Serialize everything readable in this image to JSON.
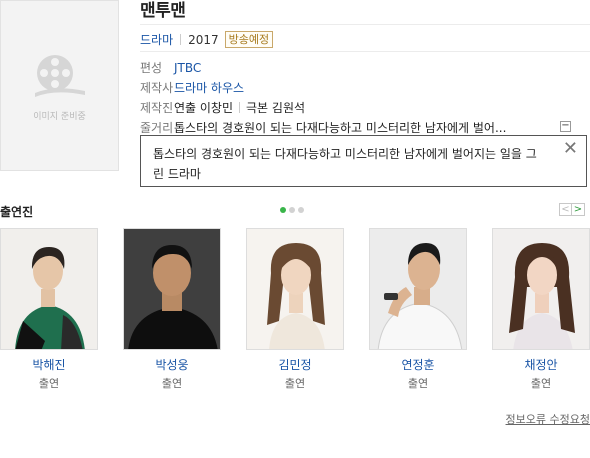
{
  "poster": {
    "placeholder_text": "이미지 준비중"
  },
  "title": "맨투맨",
  "meta": {
    "genre": "드라마",
    "year": "2017",
    "status_badge": "방송예정"
  },
  "info": [
    {
      "label": "편성",
      "value": "JTBC"
    },
    {
      "label": "제작사",
      "value": "드라마 하우스"
    },
    {
      "label": "제작진",
      "value": "연출 이창민",
      "value2": "극본 김원석"
    },
    {
      "label": "줄거리",
      "value": "톱스타의 경호원이 되는 다재다능하고 미스터리한 남자에게 벌어..."
    }
  ],
  "collapse_label": "−",
  "synopsis_popup": {
    "text": "톱스타의 경호원이 되는 다재다능하고 미스터리한 남자에게 벌어지는 일을 그린 드라마",
    "close_label": "✕"
  },
  "cast_section": {
    "heading": "출연진",
    "prev_label": "<",
    "next_label": ">",
    "members": [
      {
        "name": "박해진",
        "role": "출연"
      },
      {
        "name": "박성웅",
        "role": "출연"
      },
      {
        "name": "김민정",
        "role": "출연"
      },
      {
        "name": "연정훈",
        "role": "출연"
      },
      {
        "name": "채정안",
        "role": "출연"
      }
    ]
  },
  "report_link": "정보오류 수정요청",
  "colors": {
    "link": "#1a55a6",
    "badge": "#a77a1d",
    "active_dot": "#39b54a"
  },
  "icons": [
    "film-reel-icon",
    "close-icon",
    "collapse-icon",
    "chevron-left-icon",
    "chevron-right-icon"
  ]
}
